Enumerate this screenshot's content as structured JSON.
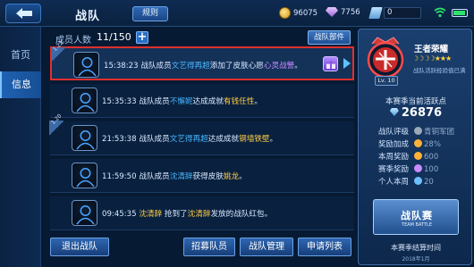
{
  "header": {
    "title": "战队",
    "rules_label": "规则",
    "gold": "96075",
    "diamonds": "7756",
    "tickets": "0"
  },
  "sidebar": {
    "items": [
      {
        "label": "首页",
        "active": false
      },
      {
        "label": "信息",
        "active": true
      }
    ]
  },
  "members": {
    "label": "成员人数",
    "count": "11/150",
    "team_button": "战队部件"
  },
  "feed": [
    {
      "tag": "1.22",
      "time": "15:38:23",
      "prefix": "战队成员",
      "name": "文艺得再超",
      "action": "添加了皮肤心愿",
      "item": "心灵战警",
      "end": "。",
      "item_color": "purple",
      "selected": true,
      "gift": true
    },
    {
      "tag": "",
      "time": "15:35:33",
      "prefix": "战队成员",
      "name": "不懈妮",
      "action": "达成成就",
      "item": "有钱任性",
      "end": "。",
      "item_color": "gold",
      "selected": false,
      "gift": false
    },
    {
      "tag": "1.20",
      "time": "21:53:38",
      "prefix": "战队成员",
      "name": "文艺得再超",
      "action": "达成成就",
      "item": "钢墙铁壁",
      "end": "。",
      "item_color": "gold",
      "selected": false,
      "gift": false
    },
    {
      "tag": "",
      "time": "11:59:50",
      "prefix": "战队成员",
      "name": "沈清辞",
      "action": "获得皮肤",
      "item": "姚龙",
      "end": "。",
      "item_color": "gold",
      "selected": false,
      "gift": false
    },
    {
      "tag": "",
      "time": "09:45:35",
      "prefix": "",
      "name": "沈清辞",
      "action": " 抢到了",
      "item": "沈清辞",
      "end": "发放的战队红包。",
      "item_color": "gold",
      "selected": false,
      "gift": false
    }
  ],
  "buttons": {
    "leave": "退出战队",
    "recruit": "招募队员",
    "manage": "战队管理",
    "applications": "申请列表"
  },
  "panel": {
    "rank_title": "王者荣耀",
    "rank_sub": "战队活跃经验值已满",
    "level": "Lv. 10",
    "activity_label": "本赛季当前活跃点",
    "activity_value": "26876",
    "stats": [
      {
        "label": "战队评级",
        "value": "青铜军团",
        "color": "#9aa8b8"
      },
      {
        "label": "奖励加成",
        "value": "28%",
        "color": "#ffb13a"
      },
      {
        "label": "本周奖励",
        "value": "600",
        "color": "#ffb13a"
      },
      {
        "label": "赛季奖励",
        "value": "100",
        "color": "#c88cff"
      },
      {
        "label": "个人本周",
        "value": "20",
        "color": "#6fbfff"
      }
    ],
    "battle_label": "战队赛",
    "battle_sub": "TEAM BATTLE",
    "season_label": "本赛季结算时间",
    "season_date": "2018年1月"
  }
}
